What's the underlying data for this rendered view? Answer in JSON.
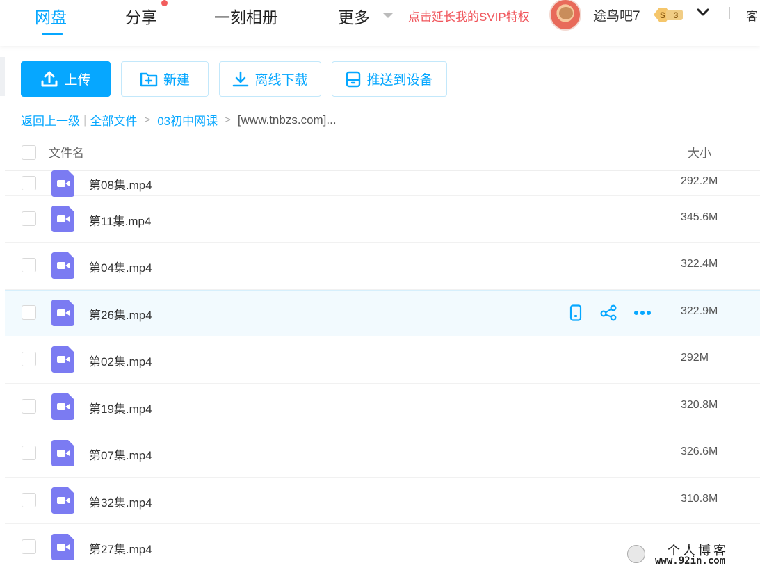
{
  "nav": {
    "items": [
      {
        "label": "网盘",
        "active": true
      },
      {
        "label": "分享",
        "has_dot": true
      },
      {
        "label": "一刻相册"
      },
      {
        "label": "更多"
      }
    ],
    "svip_promo": "点击延长我的SVIP特权",
    "username": "途鸟吧7",
    "vip_level": "3",
    "vip_prefix": "S",
    "client_label": "客"
  },
  "toolbar": {
    "upload": "上传",
    "new_folder": "新建",
    "offline_download": "离线下载",
    "push_to_device": "推送到设备"
  },
  "breadcrumb": {
    "back": "返回上一级",
    "root": "全部文件",
    "level1": "03初中网课",
    "current": "[www.tnbzs.com]..."
  },
  "list": {
    "col_name": "文件名",
    "col_size": "大小",
    "files": [
      {
        "name": "第08集.mp4",
        "size": "292.2M"
      },
      {
        "name": "第11集.mp4",
        "size": "345.6M"
      },
      {
        "name": "第04集.mp4",
        "size": "322.4M"
      },
      {
        "name": "第26集.mp4",
        "size": "322.9M"
      },
      {
        "name": "第02集.mp4",
        "size": "292M"
      },
      {
        "name": "第19集.mp4",
        "size": "320.8M"
      },
      {
        "name": "第07集.mp4",
        "size": "326.6M"
      },
      {
        "name": "第32集.mp4",
        "size": "310.8M"
      },
      {
        "name": "第27集.mp4",
        "size": ""
      }
    ],
    "hover_row_index": 3
  },
  "watermark": {
    "title": "个人博客",
    "url": "www.92in.com"
  },
  "colors": {
    "accent": "#06a7ff",
    "promo_red": "#f0555b",
    "video_icon": "#7b7bf2",
    "hover_row_bg": "#f2fafe"
  },
  "icons": {
    "upload": "upload-icon",
    "new_folder": "folder-plus-icon",
    "download": "download-icon",
    "device": "device-icon",
    "video": "video-file-icon",
    "row_push": "phone-icon",
    "row_share": "share-icon",
    "row_more": "more-dots-icon"
  }
}
